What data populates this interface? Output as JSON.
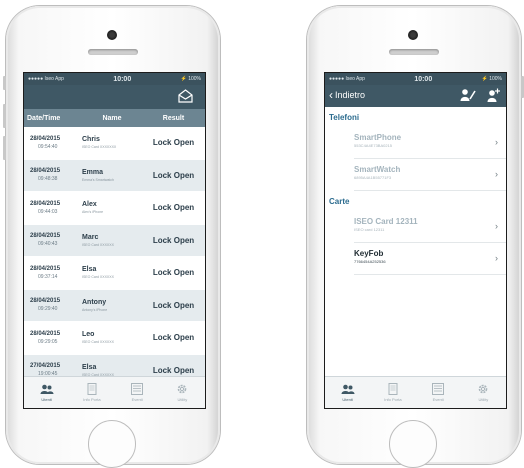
{
  "left_phone": {
    "status": {
      "carrier": "●●●●● Iseo App",
      "time": "10:00",
      "battery": "⚡ 100%"
    },
    "header_icon": "mail-open-icon",
    "columns": [
      "Date/Time",
      "Name",
      "Result"
    ],
    "rows": [
      {
        "date": "28/04/2015",
        "time": "09:54:40",
        "name": "Chris",
        "sub": "ISEO Card XXXXXXX",
        "result": "Lock Open"
      },
      {
        "date": "28/04/2015",
        "time": "09:48:38",
        "name": "Emma",
        "sub": "Emma's Smartwatch",
        "result": "Lock Open"
      },
      {
        "date": "28/04/2015",
        "time": "09:44:03",
        "name": "Alex",
        "sub": "Alex's iPhone",
        "result": "Lock Open"
      },
      {
        "date": "28/04/2015",
        "time": "09:40:43",
        "name": "Marc",
        "sub": "ISEO Card XXXXXX",
        "result": "Lock Open"
      },
      {
        "date": "28/04/2015",
        "time": "09:37:14",
        "name": "Elsa",
        "sub": "ISEO Card XXXXXX",
        "result": "Lock Open"
      },
      {
        "date": "28/04/2015",
        "time": "09:29:40",
        "name": "Antony",
        "sub": "Antony's iPhone",
        "result": "Lock Open"
      },
      {
        "date": "28/04/2015",
        "time": "09:29:05",
        "name": "Leo",
        "sub": "ISEO Card XXXXXX",
        "result": "Lock Open"
      },
      {
        "date": "27/04/2015",
        "time": "19:00:45",
        "name": "Elsa",
        "sub": "ISEO Card XXXXXX",
        "result": "Lock Open"
      }
    ],
    "tabs": [
      {
        "label": "Utenti",
        "icon": "users-icon"
      },
      {
        "label": "Info Porta",
        "icon": "door-icon"
      },
      {
        "label": "Eventi",
        "icon": "events-icon"
      },
      {
        "label": "Utility",
        "icon": "gear-icon"
      }
    ]
  },
  "right_phone": {
    "status": {
      "carrier": "●●●●● Iseo App",
      "time": "10:00",
      "battery": "⚡ 100%"
    },
    "back_label": "Indietro",
    "sections": [
      {
        "title": "Telefoni",
        "items": [
          {
            "title": "SmartPhone",
            "sub": "553C4A4E73BA0215"
          },
          {
            "title": "SmartWatch",
            "sub": "6895A4A1B55771F3"
          }
        ]
      },
      {
        "title": "Carte",
        "items": [
          {
            "title": "ISEO Card 12311",
            "sub": "ISEO card 12311"
          },
          {
            "title": "KeyFob",
            "sub": "7766454A252536"
          }
        ]
      }
    ],
    "tabs": [
      {
        "label": "Utenti",
        "icon": "users-icon"
      },
      {
        "label": "Info Porta",
        "icon": "door-icon"
      },
      {
        "label": "Eventi",
        "icon": "events-icon"
      },
      {
        "label": "Utility",
        "icon": "gear-icon"
      }
    ]
  }
}
